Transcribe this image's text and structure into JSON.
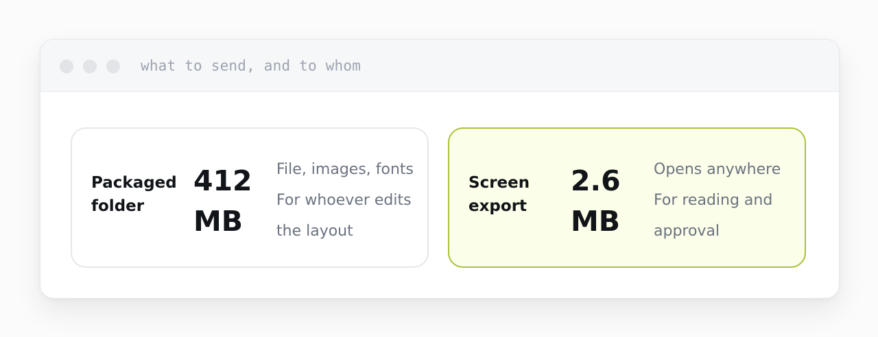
{
  "window": {
    "title": "what to send, and to whom"
  },
  "options": [
    {
      "label": "Packaged folder",
      "size": "412 MB",
      "notes": [
        "File, images, fonts",
        "For whoever edits the layout"
      ]
    },
    {
      "label": "Screen export",
      "size": "2.6 MB",
      "notes": [
        "Opens anywhere",
        "For reading and approval"
      ]
    }
  ],
  "colors": {
    "highlight_border": "#a8c338",
    "highlight_background": "#fbfee8",
    "title_text": "#9ca3af",
    "note_text": "#6b7280"
  }
}
